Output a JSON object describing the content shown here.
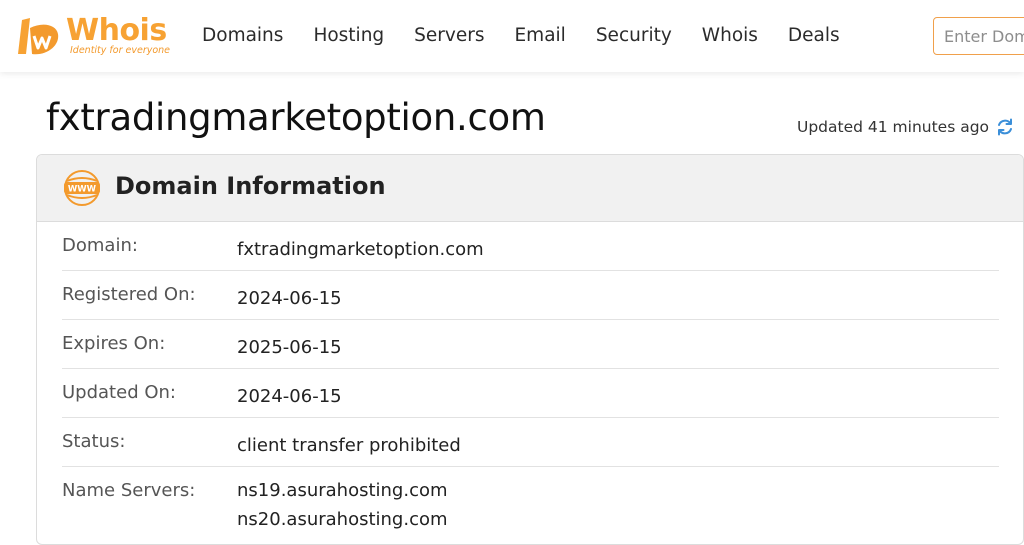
{
  "header": {
    "logo_text": "Whois",
    "logo_tagline": "Identity for everyone",
    "nav": [
      "Domains",
      "Hosting",
      "Servers",
      "Email",
      "Security",
      "Whois",
      "Deals"
    ],
    "search_placeholder": "Enter Domain"
  },
  "page": {
    "title": "fxtradingmarketoption.com",
    "updated_text": "Updated 41 minutes ago"
  },
  "card": {
    "title": "Domain Information",
    "rows": [
      {
        "label": "Domain:",
        "value": "fxtradingmarketoption.com"
      },
      {
        "label": "Registered On:",
        "value": "2024-06-15"
      },
      {
        "label": "Expires On:",
        "value": "2025-06-15"
      },
      {
        "label": "Updated On:",
        "value": "2024-06-15"
      },
      {
        "label": "Status:",
        "value": "client transfer prohibited"
      },
      {
        "label": "Name Servers:",
        "values": [
          "ns19.asurahosting.com",
          "ns20.asurahosting.com"
        ]
      }
    ]
  },
  "colors": {
    "brand_orange": "#f7a233",
    "refresh_blue": "#3b8fd9"
  },
  "icons": [
    "logo-mark-icon",
    "refresh-icon",
    "www-icon"
  ]
}
